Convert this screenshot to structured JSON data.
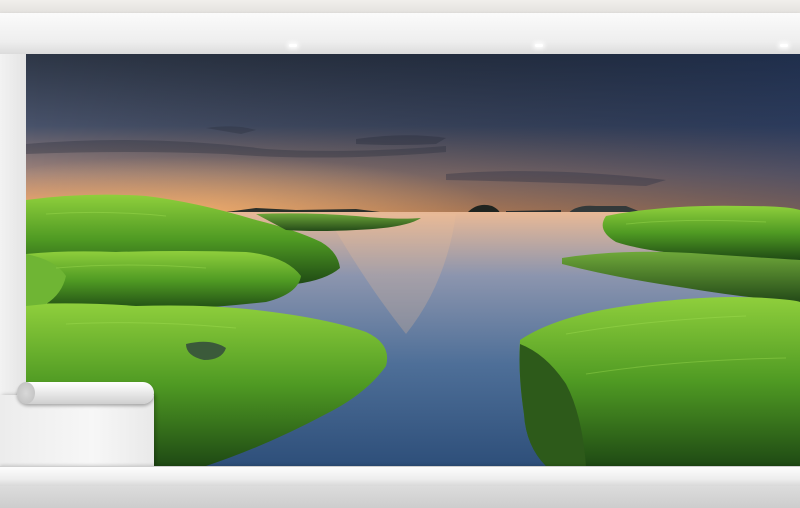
{
  "scene": {
    "description_tags": [
      "wall-mural",
      "seascape",
      "mossy-rocks",
      "sunset-sky"
    ],
    "colors": {
      "sky_top": "#2e3a4c",
      "sky_horizon": "#f2a56a",
      "water": "#4a6f9a",
      "moss": "#5fa62a",
      "wall": "#e9e9e9"
    }
  }
}
